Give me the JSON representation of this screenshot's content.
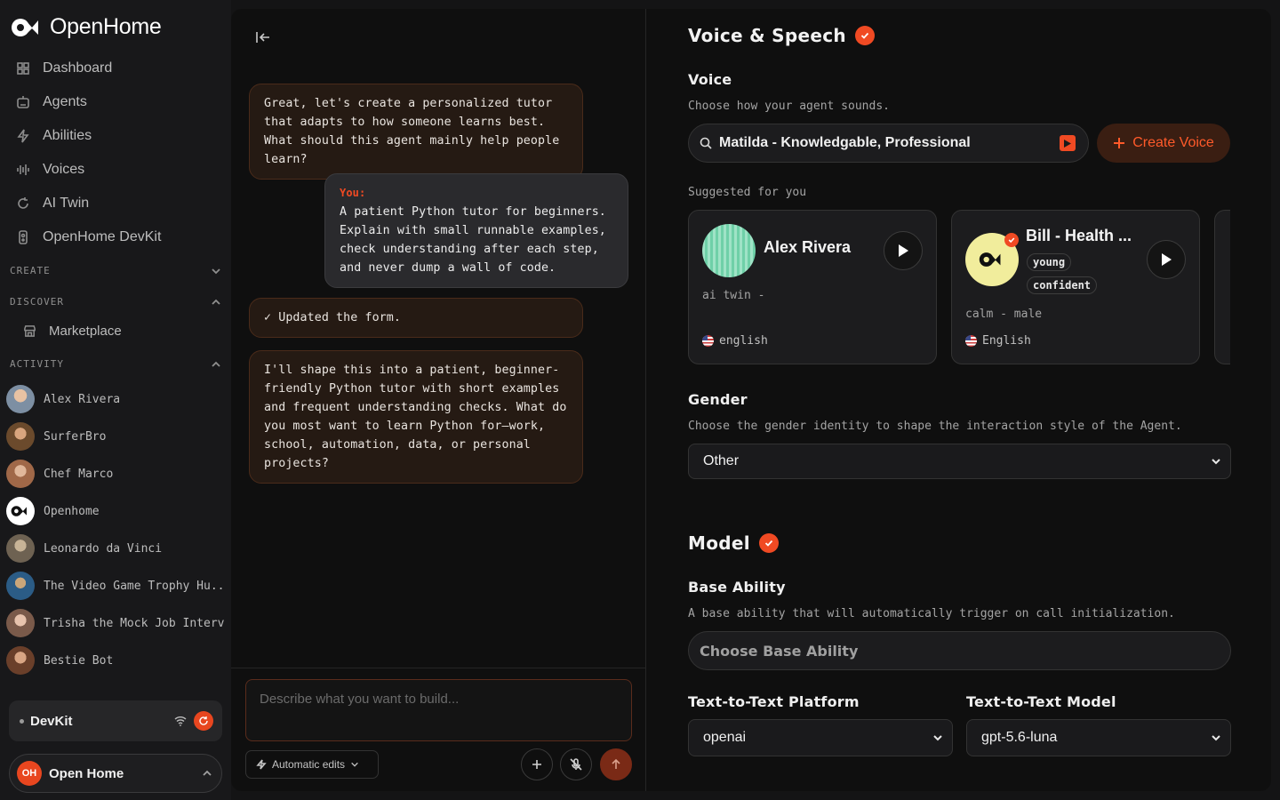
{
  "brand": {
    "name": "OpenHome"
  },
  "nav": {
    "items": [
      {
        "label": "Dashboard",
        "icon": "grid-icon"
      },
      {
        "label": "Agents",
        "icon": "bot-icon"
      },
      {
        "label": "Abilities",
        "icon": "bolt-icon"
      },
      {
        "label": "Voices",
        "icon": "waveform-icon"
      },
      {
        "label": "AI Twin",
        "icon": "refresh-icon"
      },
      {
        "label": "OpenHome DevKit",
        "icon": "device-icon"
      }
    ]
  },
  "sections": {
    "create": "CREATE",
    "discover": "DISCOVER",
    "marketplace": "Marketplace",
    "activity": "ACTIVITY"
  },
  "activity": [
    {
      "name": "Alex Rivera",
      "color": "#7d8fa3"
    },
    {
      "name": "SurferBro",
      "color": "#8a6a4a"
    },
    {
      "name": "Chef Marco",
      "color": "#a57b5c"
    },
    {
      "name": "Openhome",
      "color": "#ffffff"
    },
    {
      "name": "Leonardo da Vinci",
      "color": "#9a8a74"
    },
    {
      "name": "The Video Game Trophy Hu...",
      "color": "#3b6f9e"
    },
    {
      "name": "Trisha the Mock Job Intervi...",
      "color": "#b58e7a"
    },
    {
      "name": "Bestie Bot",
      "color": "#8e5f45"
    }
  ],
  "devkit": {
    "label": "DevKit"
  },
  "user": {
    "initials": "OH",
    "name": "Open Home"
  },
  "chat": {
    "messages": [
      {
        "role": "ai",
        "text": "Great, let's create a personalized tutor that adapts to how someone learns best. What should this agent mainly help people learn?"
      },
      {
        "role": "you",
        "label": "You:",
        "text": "A patient Python tutor for beginners. Explain with small runnable examples, check understanding after each step, and never dump a wall of code."
      },
      {
        "role": "ai",
        "text": "✓ Updated the form."
      },
      {
        "role": "ai",
        "text": "I'll shape this into a patient, beginner-friendly Python tutor with short examples and frequent understanding checks. What do you most want to learn Python for—work, school, automation, data, or personal projects?"
      }
    ],
    "input_placeholder": "Describe what you want to build...",
    "auto_edits": "Automatic edits"
  },
  "form": {
    "voice_section": "Voice & Speech",
    "voice_label": "Voice",
    "voice_desc": "Choose how your agent sounds.",
    "voice_value": "Matilda - Knowledgable, Professional",
    "create_voice": "Create Voice",
    "suggested": "Suggested for you",
    "cards": [
      {
        "name": "Alex Rivera",
        "sub": "ai twin -",
        "lang": "english"
      },
      {
        "name": "Bill - Health ...",
        "tags": [
          "young",
          "confident"
        ],
        "sub": "calm - male",
        "lang": "English"
      }
    ],
    "gender_label": "Gender",
    "gender_desc": "Choose the gender identity to shape the interaction style of the Agent.",
    "gender_value": "Other",
    "model_section": "Model",
    "base_label": "Base Ability",
    "base_desc": "A base ability that will automatically trigger on call initialization.",
    "base_placeholder": "Choose Base Ability",
    "ttt_platform_label": "Text-to-Text Platform",
    "ttt_platform_value": "openai",
    "ttt_model_label": "Text-to-Text Model",
    "ttt_model_value": "gpt-5.6-luna"
  },
  "colors": {
    "accent": "#f04a23",
    "bg": "#0f0f0f",
    "sidebar": "#18181a"
  }
}
